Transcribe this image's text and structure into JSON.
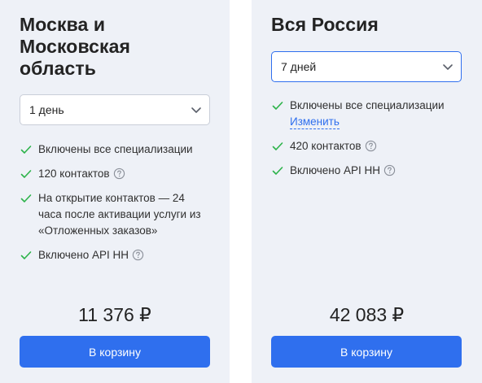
{
  "cards": [
    {
      "title": "Москва и Московская область",
      "period": "1 день",
      "features": [
        "Включены все специализации",
        "120 контактов",
        "На открытие контактов — 24 часа после активации услуги из «Отложенных заказов»",
        "Включено API HH"
      ],
      "price": "11 376 ₽",
      "cart_label": "В корзину"
    },
    {
      "title": "Вся Россия",
      "period": "7 дней",
      "features": [
        "Включены все специализации",
        "420 контактов",
        "Включено API HH"
      ],
      "change_link": "Изменить",
      "price": "42 083 ₽",
      "cart_label": "В корзину"
    }
  ],
  "colors": {
    "card_bg": "#eef1f7",
    "accent": "#2f6fee",
    "check": "#2db34a"
  },
  "icons": {
    "check": "check-icon",
    "help": "question-circle-icon",
    "chevron": "chevron-down-icon"
  }
}
